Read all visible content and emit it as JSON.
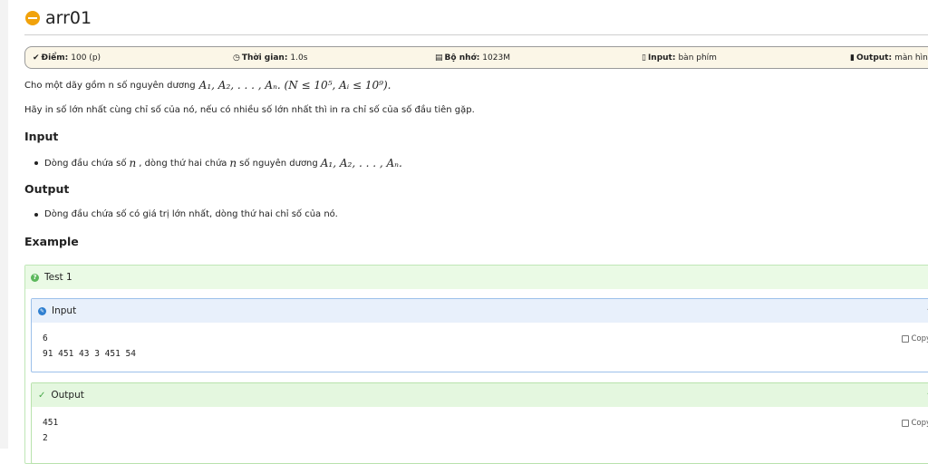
{
  "problem": {
    "title": "arr01",
    "info": {
      "score_label": "Điểm:",
      "score_value": "100 (p)",
      "time_label": "Thời gian:",
      "time_value": "1.0s",
      "memory_label": "Bộ nhớ:",
      "memory_value": "1023M",
      "input_label": "Input:",
      "input_value": "bàn phím",
      "output_label": "Output:",
      "output_value": "màn hình"
    },
    "statement": {
      "p1": "Cho một dãy gồm n số nguyên dương",
      "p1_math": "A₁, A₂, . . . , Aₙ. (N ≤ 10⁵, Aᵢ ≤ 10⁹).",
      "p2": "Hãy in số lớn nhất cùng chỉ số của nó, nếu có nhiều số lớn nhất thì in ra chỉ số của số đầu tiên gặp."
    },
    "input_heading": "Input",
    "input_item_1": "Dòng đầu chứa số",
    "input_item_math_1": "n",
    "input_item_2": ", dòng thứ hai chứa",
    "input_item_math_2": "n",
    "input_item_3": "số nguyên dương",
    "input_item_math_3": "A₁, A₂, . . . , Aₙ.",
    "output_heading": "Output",
    "output_item": "Dòng đầu chứa số có giá trị lớn nhất, dòng thứ hai chỉ số của nó.",
    "example_heading": "Example"
  },
  "test": {
    "title": "Test 1",
    "input_title": "Input",
    "input_lines": [
      "6",
      "91 451 43 3 451 54"
    ],
    "output_title": "Output",
    "output_lines": [
      "451",
      "2"
    ],
    "copy_label": "Copy"
  }
}
